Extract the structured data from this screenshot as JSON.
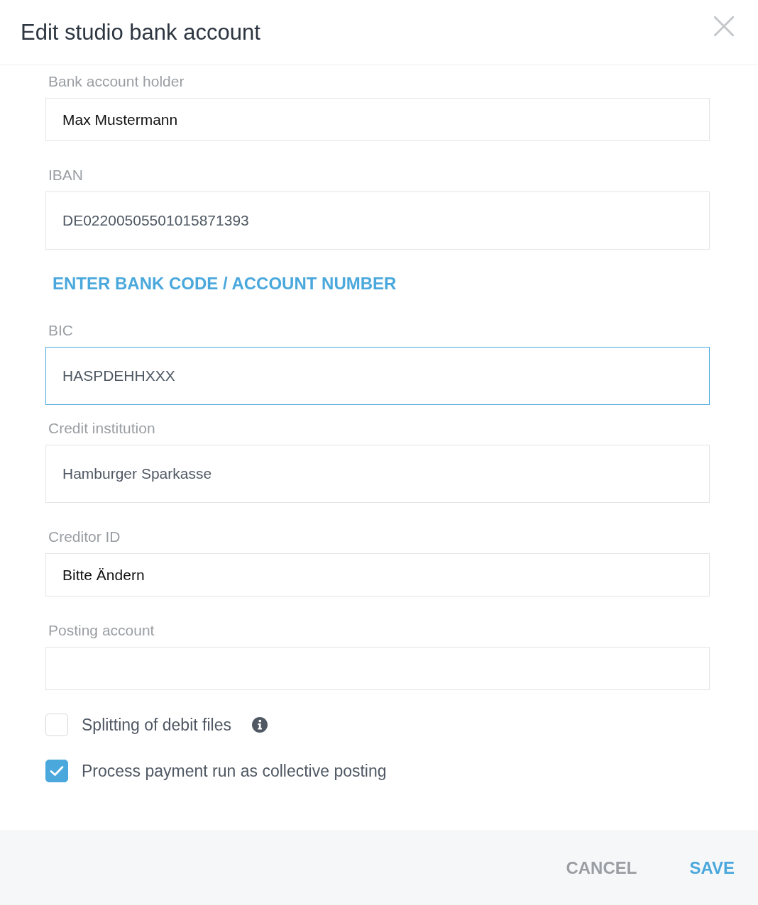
{
  "dialog": {
    "title": "Edit studio bank account"
  },
  "form": [
    {
      "kind": "input",
      "label": "Bank account holder",
      "value": "Max Mustermann",
      "focused": false
    },
    {
      "kind": "lookup",
      "label": "IBAN",
      "value": "DE02200505501015871393",
      "focused": false
    },
    {
      "kind": "link",
      "text": "ENTER BANK CODE / ACCOUNT NUMBER"
    },
    {
      "kind": "lookup",
      "label": "BIC",
      "value": "HASPDEHHXXX",
      "focused": true
    },
    {
      "kind": "lookup",
      "label": "Credit institution",
      "value": "Hamburger Sparkasse",
      "focused": false
    },
    {
      "kind": "input",
      "label": "Creditor ID",
      "value": "Bitte Ändern",
      "focused": false
    },
    {
      "kind": "input",
      "label": "Posting account",
      "focused": false
    }
  ],
  "options": [
    {
      "label": "Splitting of debit files",
      "checked": false,
      "info": true
    },
    {
      "label": "Process payment run as collective posting",
      "checked": true,
      "info": false
    }
  ],
  "footer": {
    "buttons": [
      {
        "label": "CANCEL",
        "kind": "secondary"
      },
      {
        "label": "SAVE",
        "kind": "primary"
      }
    ]
  }
}
